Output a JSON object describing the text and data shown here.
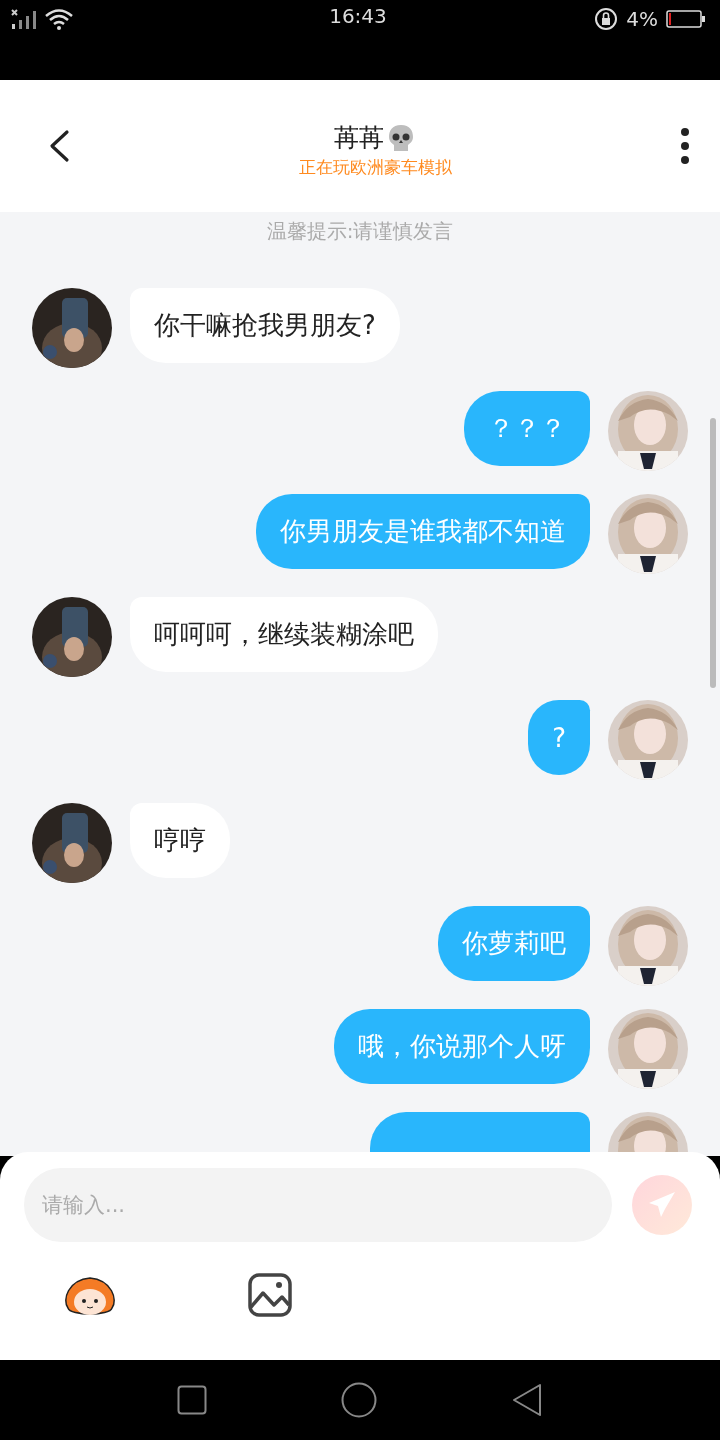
{
  "status_bar": {
    "time": "16:43",
    "battery": "4%"
  },
  "header": {
    "title": "苒苒",
    "subtitle": "正在玩欧洲豪车模拟"
  },
  "tip": "温馨提示:请谨慎发言",
  "messages": [
    {
      "kind": "received",
      "text": "你干嘛抢我男朋友?"
    },
    {
      "kind": "sent",
      "text": "？？？"
    },
    {
      "kind": "sent",
      "text": "你男朋友是谁我都不知道"
    },
    {
      "kind": "received",
      "text": "呵呵呵，继续装糊涂吧"
    },
    {
      "kind": "sent",
      "text": "?"
    },
    {
      "kind": "received",
      "text": "哼哼"
    },
    {
      "kind": "sent",
      "text": "你萝莉吧"
    },
    {
      "kind": "sent",
      "text": "哦，你说那个人呀"
    },
    {
      "kind": "sent"
    }
  ],
  "composer": {
    "placeholder": "请输入..."
  }
}
